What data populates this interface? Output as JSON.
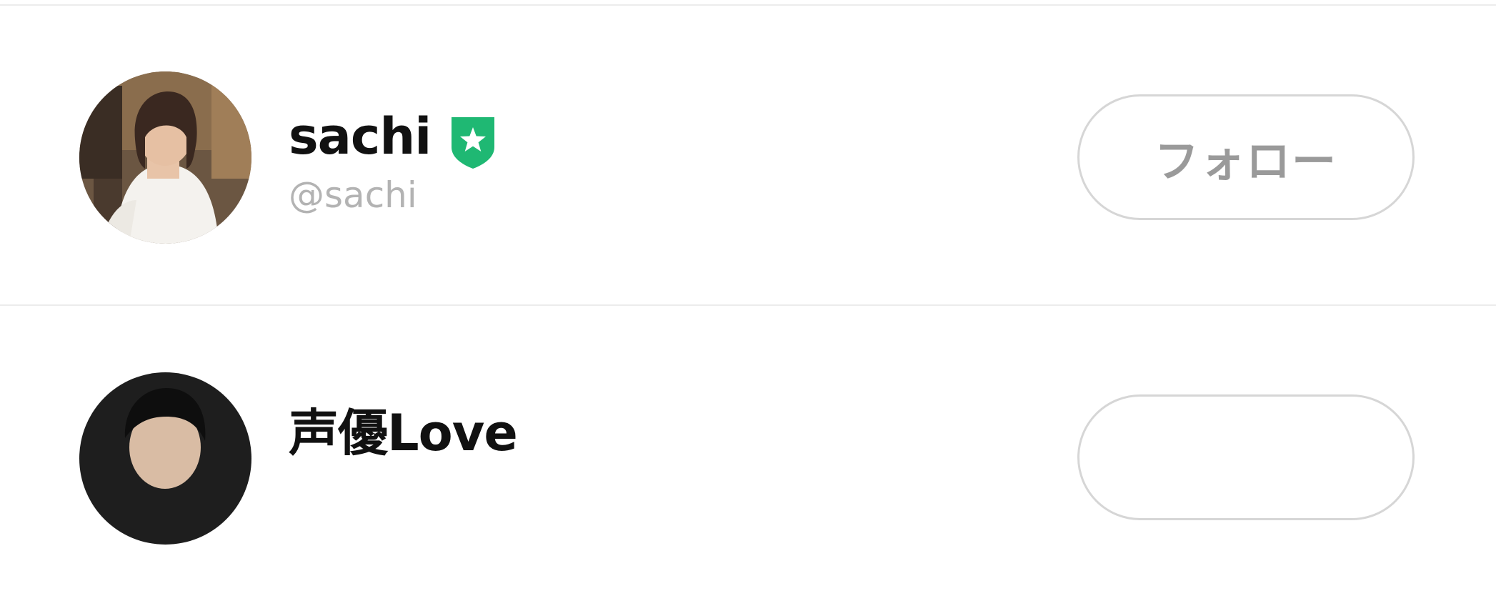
{
  "users": [
    {
      "name": "sachi",
      "handle": "@sachi",
      "verified": true,
      "follow_label": "フォロー",
      "badge_color": "#1fb873"
    },
    {
      "name": "声優Love",
      "follow_label": ""
    }
  ],
  "colors": {
    "divider": "#ececec",
    "button_border": "#d6d6d6",
    "button_text": "#9a9a9a",
    "handle_text": "#b3b3b3"
  }
}
